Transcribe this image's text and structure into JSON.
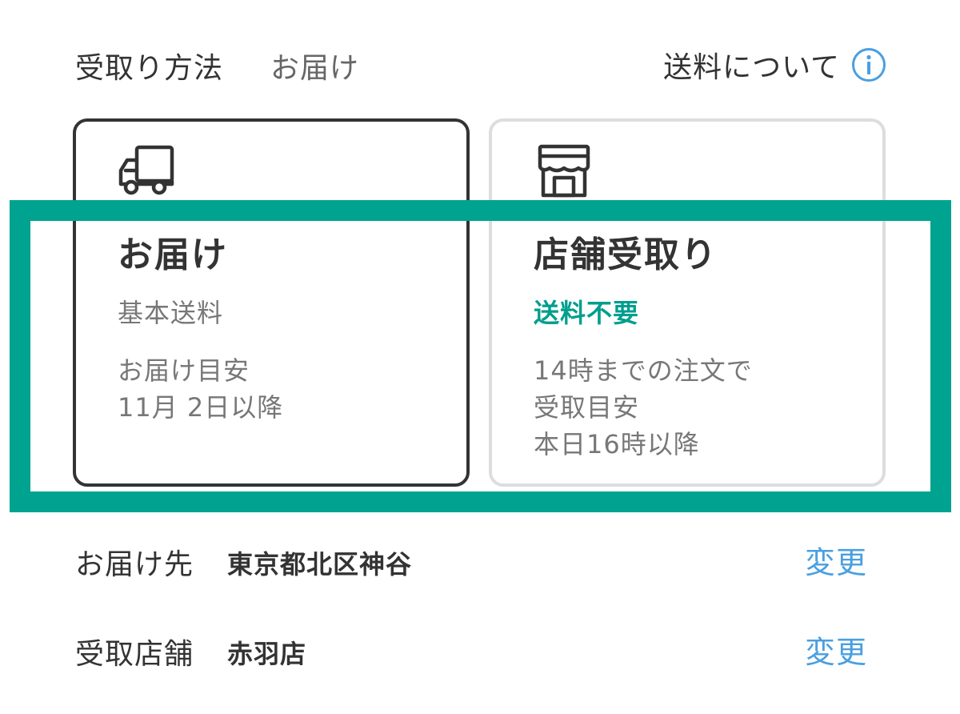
{
  "header": {
    "method_label": "受取り方法",
    "method_value": "お届け",
    "shipping_info_label": "送料について",
    "info_icon": "info-circle-icon"
  },
  "cards": {
    "delivery": {
      "icon": "truck-icon",
      "title": "お届け",
      "fee_label": "基本送料",
      "estimate_label": "お届け目安",
      "estimate_date": "11月 2日以降"
    },
    "pickup": {
      "icon": "store-icon",
      "title": "店舗受取り",
      "fee_label": "送料不要",
      "note_line1": "14時までの注文で",
      "note_line2": "受取目安",
      "note_line3": "本日16時以降"
    }
  },
  "destination": {
    "label": "お届け先",
    "value": "東京都北区神谷",
    "change_label": "変更"
  },
  "store": {
    "label": "受取店舗",
    "value": "赤羽店",
    "change_label": "変更"
  },
  "colors": {
    "accent_teal": "#00a390",
    "link_blue": "#4a9fe0",
    "selected_border": "#333333",
    "unselected_border": "#dddddd"
  }
}
